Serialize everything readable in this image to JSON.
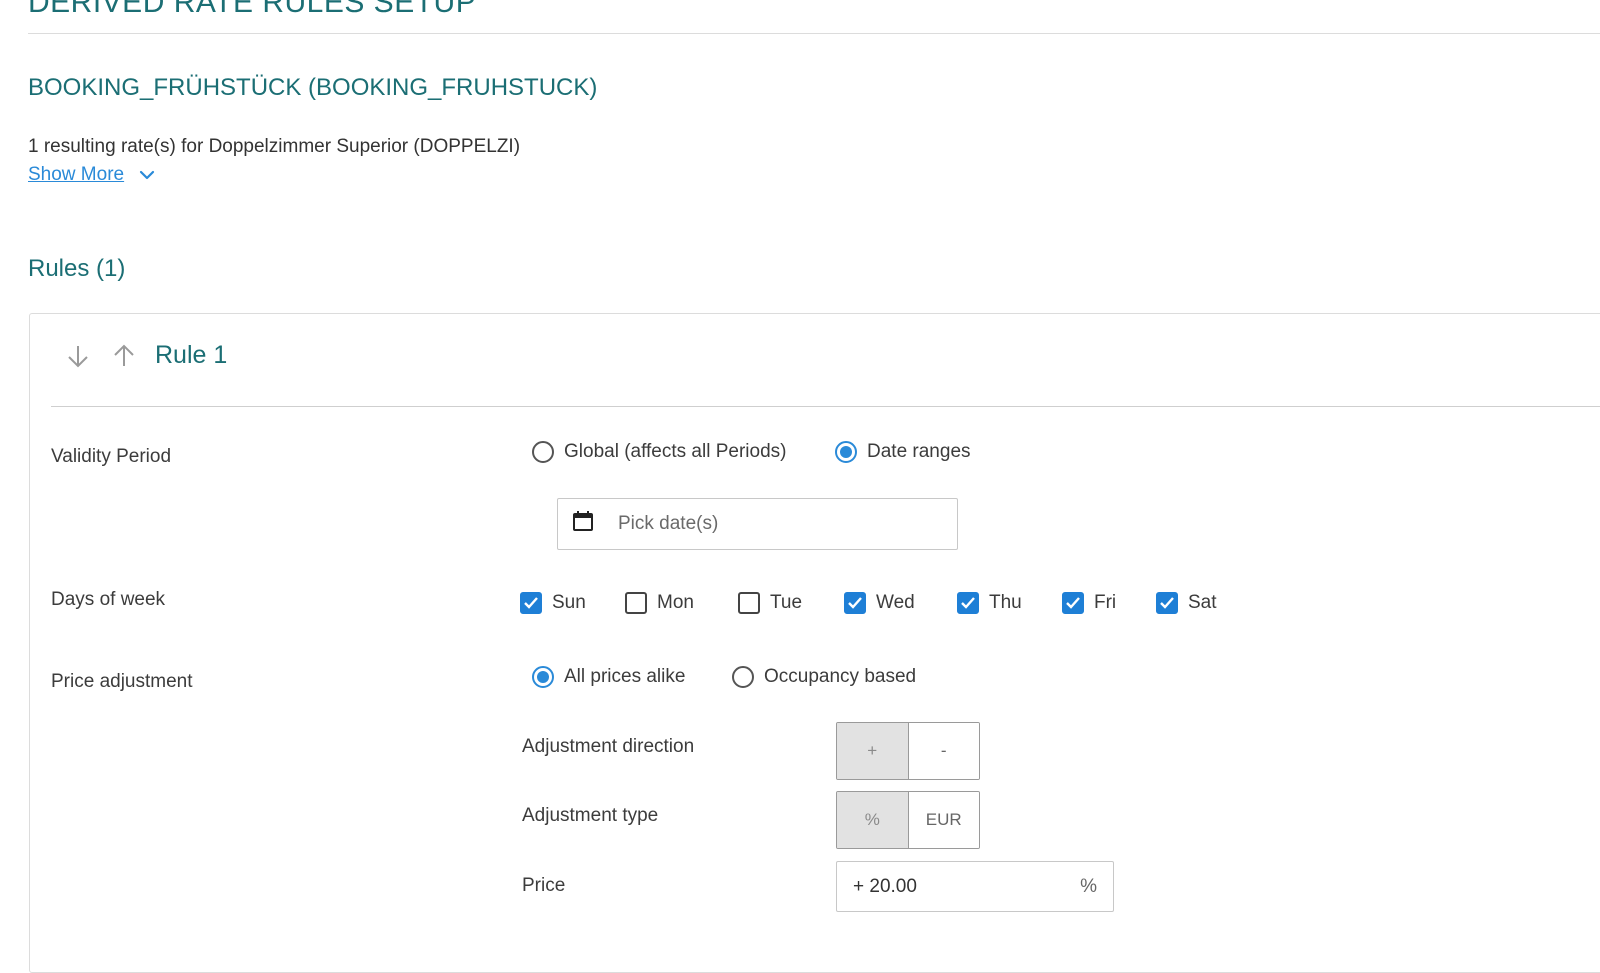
{
  "page": {
    "title": "DERIVED RATE RULES SETUP",
    "rate_code": "BOOKING_FRÜHSTÜCK (BOOKING_FRUHSTUCK)",
    "result_text": "1 resulting rate(s) for Doppelzimmer Superior (DOPPELZI)",
    "show_more_label": "Show More",
    "rules_heading": "Rules (1)"
  },
  "rule": {
    "title": "Rule 1",
    "validity": {
      "label": "Validity Period",
      "options": [
        "Global (affects all Periods)",
        "Date ranges"
      ],
      "selected": "Date ranges",
      "date_placeholder": "Pick date(s)"
    },
    "days": {
      "label": "Days of week",
      "items": [
        {
          "label": "Sun",
          "checked": true
        },
        {
          "label": "Mon",
          "checked": false
        },
        {
          "label": "Tue",
          "checked": false
        },
        {
          "label": "Wed",
          "checked": true
        },
        {
          "label": "Thu",
          "checked": true
        },
        {
          "label": "Fri",
          "checked": true
        },
        {
          "label": "Sat",
          "checked": true
        }
      ]
    },
    "price_adjustment": {
      "label": "Price adjustment",
      "options": [
        "All prices alike",
        "Occupancy based"
      ],
      "selected": "All prices alike",
      "direction_label": "Adjustment direction",
      "direction_options": [
        "+",
        "-"
      ],
      "direction_selected": "+",
      "type_label": "Adjustment type",
      "type_options": [
        "%",
        "EUR"
      ],
      "type_selected": "%",
      "price_label": "Price",
      "price_value": "+ 20.00",
      "price_unit": "%"
    }
  },
  "colors": {
    "heading": "#1b6e74",
    "accent": "#2a8ad8",
    "checkbox": "#1e7fd6"
  }
}
